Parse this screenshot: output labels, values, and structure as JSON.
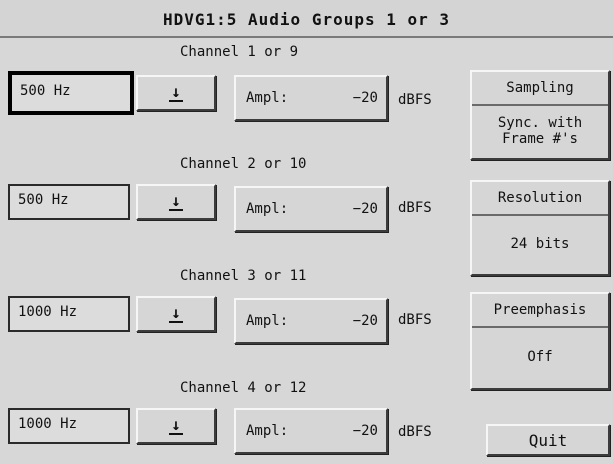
{
  "title": "HDVG1:5  Audio  Groups  1  or 3",
  "channels": [
    {
      "label": "Channel 1 or 9",
      "freq": "500 Hz",
      "ampl_label": "Ampl:",
      "ampl_value": "−20",
      "unit": "dBFS"
    },
    {
      "label": "Channel 2 or 10",
      "freq": "500 Hz",
      "ampl_label": "Ampl:",
      "ampl_value": "−20",
      "unit": "dBFS"
    },
    {
      "label": "Channel 3 or 11",
      "freq": "1000 Hz",
      "ampl_label": "Ampl:",
      "ampl_value": "−20",
      "unit": "dBFS"
    },
    {
      "label": "Channel 4 or 12",
      "freq": "1000 Hz",
      "ampl_label": "Ampl:",
      "ampl_value": "−20",
      "unit": "dBFS"
    }
  ],
  "dropdown_icon": "down-arrow-icon",
  "dropdown_glyph": "↓",
  "sampling": {
    "label": "Sampling",
    "value_line1": "Sync. with",
    "value_line2": "Frame #'s"
  },
  "resolution": {
    "label": "Resolution",
    "value": "24 bits"
  },
  "preemphasis": {
    "label": "Preemphasis",
    "value": "Off"
  },
  "quit_label": "Quit"
}
